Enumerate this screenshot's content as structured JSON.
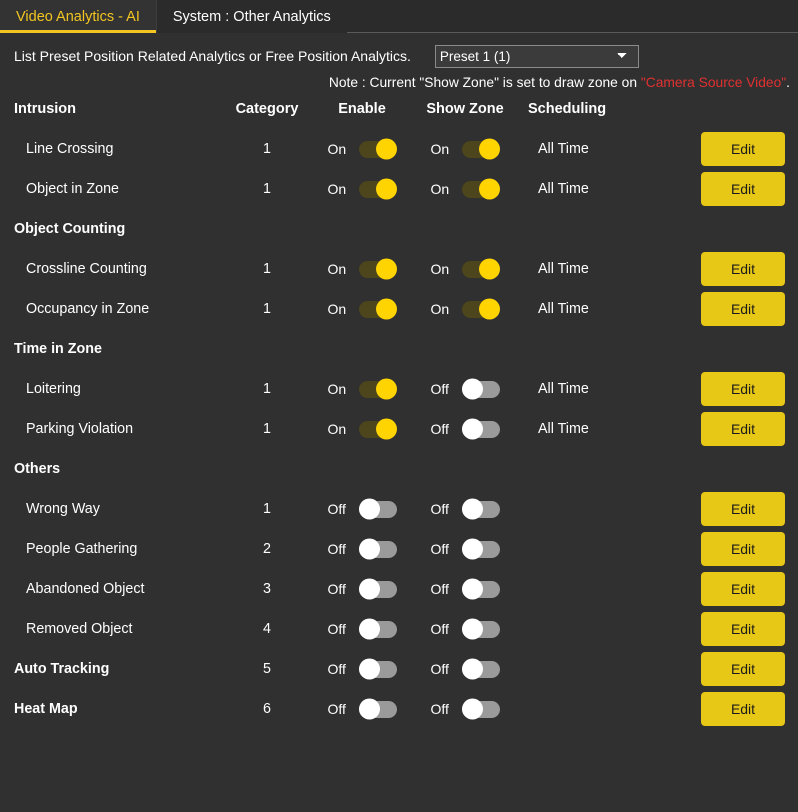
{
  "tabs": [
    {
      "label": "Video Analytics - AI",
      "active": true
    },
    {
      "label": "System : Other Analytics",
      "active": false
    }
  ],
  "toolbar": {
    "description": "List Preset Position Related Analytics or Free Position Analytics.",
    "preset_selected": "Preset 1 (1)",
    "preset_options": [
      "Preset 1 (1)"
    ]
  },
  "note": {
    "prefix": "Note : Current \"Show Zone\" is set to draw zone on ",
    "highlight": "\"Camera Source Video\"",
    "suffix": "."
  },
  "colors": {
    "accent": "#f2c521",
    "button": "#e8c817",
    "toggle_on_track": "#4d451c",
    "toggle_on_knob": "#ffd400",
    "toggle_off_track": "#9a9a9a",
    "toggle_off_knob": "#ffffff",
    "note_highlight": "#e03030",
    "background": "#303030"
  },
  "table": {
    "headers": {
      "name": "Intrusion",
      "category": "Category",
      "enable": "Enable",
      "show_zone": "Show Zone",
      "scheduling": "Scheduling",
      "action": ""
    },
    "edit_label": "Edit",
    "rows": [
      {
        "kind": "item",
        "name": "Line Crossing",
        "category": "1",
        "enable": "On",
        "enable_state": "on",
        "show_zone": "On",
        "show_zone_state": "on",
        "scheduling": "All Time",
        "edit": "Edit"
      },
      {
        "kind": "item",
        "name": "Object in Zone",
        "category": "1",
        "enable": "On",
        "enable_state": "on",
        "show_zone": "On",
        "show_zone_state": "on",
        "scheduling": "All Time",
        "edit": "Edit"
      },
      {
        "kind": "group",
        "name": "Object Counting",
        "category": "",
        "enable": "",
        "enable_state": "",
        "show_zone": "",
        "show_zone_state": "",
        "scheduling": "",
        "edit": ""
      },
      {
        "kind": "item",
        "name": "Crossline Counting",
        "category": "1",
        "enable": "On",
        "enable_state": "on",
        "show_zone": "On",
        "show_zone_state": "on",
        "scheduling": "All Time",
        "edit": "Edit"
      },
      {
        "kind": "item",
        "name": "Occupancy in Zone",
        "category": "1",
        "enable": "On",
        "enable_state": "on",
        "show_zone": "On",
        "show_zone_state": "on",
        "scheduling": "All Time",
        "edit": "Edit"
      },
      {
        "kind": "group",
        "name": "Time in Zone",
        "category": "",
        "enable": "",
        "enable_state": "",
        "show_zone": "",
        "show_zone_state": "",
        "scheduling": "",
        "edit": ""
      },
      {
        "kind": "item",
        "name": "Loitering",
        "category": "1",
        "enable": "On",
        "enable_state": "on",
        "show_zone": "Off",
        "show_zone_state": "off",
        "scheduling": "All Time",
        "edit": "Edit"
      },
      {
        "kind": "item",
        "name": "Parking Violation",
        "category": "1",
        "enable": "On",
        "enable_state": "on",
        "show_zone": "Off",
        "show_zone_state": "off",
        "scheduling": "All Time",
        "edit": "Edit"
      },
      {
        "kind": "group",
        "name": "Others",
        "category": "",
        "enable": "",
        "enable_state": "",
        "show_zone": "",
        "show_zone_state": "",
        "scheduling": "",
        "edit": ""
      },
      {
        "kind": "item",
        "name": "Wrong Way",
        "category": "1",
        "enable": "Off",
        "enable_state": "off",
        "show_zone": "Off",
        "show_zone_state": "off",
        "scheduling": "",
        "edit": "Edit"
      },
      {
        "kind": "item",
        "name": "People Gathering",
        "category": "2",
        "enable": "Off",
        "enable_state": "off",
        "show_zone": "Off",
        "show_zone_state": "off",
        "scheduling": "",
        "edit": "Edit"
      },
      {
        "kind": "item",
        "name": "Abandoned Object",
        "category": "3",
        "enable": "Off",
        "enable_state": "off",
        "show_zone": "Off",
        "show_zone_state": "off",
        "scheduling": "",
        "edit": "Edit"
      },
      {
        "kind": "item",
        "name": "Removed Object",
        "category": "4",
        "enable": "Off",
        "enable_state": "off",
        "show_zone": "Off",
        "show_zone_state": "off",
        "scheduling": "",
        "edit": "Edit"
      },
      {
        "kind": "bold",
        "name": "Auto Tracking",
        "category": "5",
        "enable": "Off",
        "enable_state": "off",
        "show_zone": "Off",
        "show_zone_state": "off",
        "scheduling": "",
        "edit": "Edit"
      },
      {
        "kind": "bold",
        "name": "Heat Map",
        "category": "6",
        "enable": "Off",
        "enable_state": "off",
        "show_zone": "Off",
        "show_zone_state": "off",
        "scheduling": "",
        "edit": "Edit"
      }
    ]
  }
}
